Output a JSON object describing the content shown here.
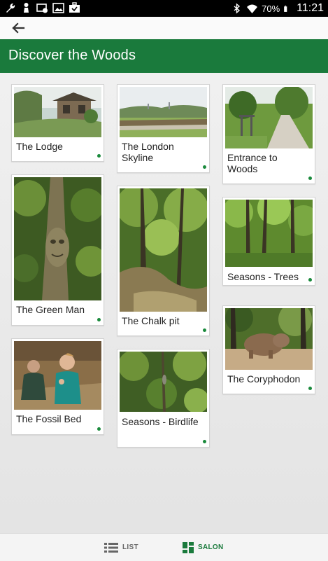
{
  "status_bar": {
    "battery": "70%",
    "time": "11:21"
  },
  "header": {
    "title": "Discover the Woods"
  },
  "cards": [
    {
      "label": "The Lodge"
    },
    {
      "label": "The London Skyline"
    },
    {
      "label": "Entrance to Woods"
    },
    {
      "label": "The Green Man"
    },
    {
      "label": "The Chalk pit"
    },
    {
      "label": "Seasons - Trees"
    },
    {
      "label": "The Fossil Bed"
    },
    {
      "label": "Seasons - Birdlife"
    },
    {
      "label": "The Coryphodon"
    }
  ],
  "bottom_nav": {
    "list_label": "LIST",
    "salon_label": "SALON",
    "active": "SALON"
  },
  "colors": {
    "accent": "#1a7a3c",
    "dot": "#1a8a3c"
  }
}
